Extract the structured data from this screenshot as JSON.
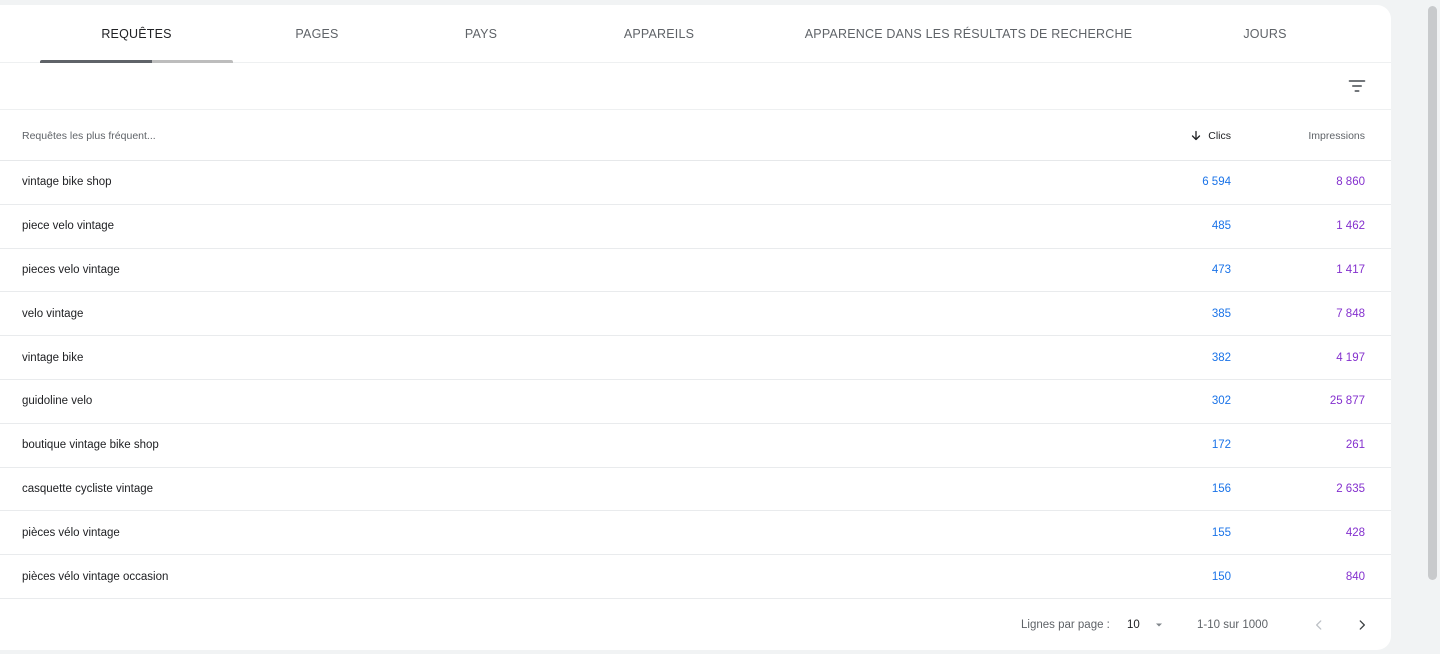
{
  "tabs": [
    {
      "label": "REQUÊTES",
      "active": true
    },
    {
      "label": "PAGES",
      "active": false
    },
    {
      "label": "PAYS",
      "active": false
    },
    {
      "label": "APPAREILS",
      "active": false
    },
    {
      "label": "APPARENCE DANS LES RÉSULTATS DE RECHERCHE",
      "active": false
    },
    {
      "label": "JOURS",
      "active": false
    }
  ],
  "filter": {
    "icon": "filter-icon"
  },
  "table": {
    "headers": {
      "query": "Requêtes les plus fréquent...",
      "clicks": "Clics",
      "impressions": "Impressions"
    },
    "sort": {
      "column": "clicks",
      "direction": "desc",
      "icon": "arrow-down-icon"
    },
    "rows": [
      {
        "query": "vintage bike shop",
        "clicks": "6 594",
        "impressions": "8 860"
      },
      {
        "query": "piece velo vintage",
        "clicks": "485",
        "impressions": "1 462"
      },
      {
        "query": "pieces velo vintage",
        "clicks": "473",
        "impressions": "1 417"
      },
      {
        "query": "velo vintage",
        "clicks": "385",
        "impressions": "7 848"
      },
      {
        "query": "vintage bike",
        "clicks": "382",
        "impressions": "4 197"
      },
      {
        "query": "guidoline velo",
        "clicks": "302",
        "impressions": "25 877"
      },
      {
        "query": "boutique vintage bike shop",
        "clicks": "172",
        "impressions": "261"
      },
      {
        "query": "casquette cycliste vintage",
        "clicks": "156",
        "impressions": "2 635"
      },
      {
        "query": "pièces vélo vintage",
        "clicks": "155",
        "impressions": "428"
      },
      {
        "query": "pièces vélo vintage occasion",
        "clicks": "150",
        "impressions": "840"
      }
    ]
  },
  "pagination": {
    "rows_per_page_label": "Lignes par page :",
    "rows_per_page_value": "10",
    "range": "1-10 sur 1000"
  },
  "colors": {
    "clicks": "#1a73e8",
    "impressions": "#8430ce",
    "text": "#202124",
    "muted": "#5f6368"
  }
}
